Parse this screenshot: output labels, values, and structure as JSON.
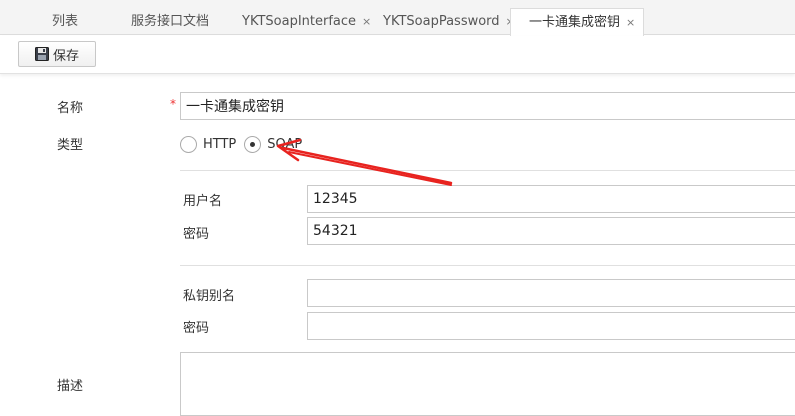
{
  "tabs": [
    {
      "label": "列表",
      "closable": false,
      "active": false
    },
    {
      "label": "服务接口文档",
      "closable": false,
      "active": false
    },
    {
      "label": "YKTSoapInterface",
      "closable": true,
      "active": false
    },
    {
      "label": "YKTSoapPassword",
      "closable": true,
      "active": false
    },
    {
      "label": "一卡通集成密钥",
      "closable": true,
      "active": true
    }
  ],
  "close_glyph": "×",
  "toolbar": {
    "save_label": "保存",
    "save_icon": "floppy-disk-icon"
  },
  "form": {
    "name_label": "名称",
    "required_mark": "*",
    "name_value": "一卡通集成密钥",
    "type_label": "类型",
    "type_options": [
      {
        "label": "HTTP",
        "selected": false
      },
      {
        "label": "SOAP",
        "selected": true
      }
    ],
    "username_label": "用户名",
    "username_value": "12345",
    "password_label": "密码",
    "password_value": "54321",
    "key_alias_label": "私钥别名",
    "key_alias_value": "",
    "key_password_label": "密码",
    "key_password_value": "",
    "description_label": "描述",
    "description_value": ""
  },
  "annotation": {
    "type": "arrow",
    "color": "#e8231f"
  }
}
